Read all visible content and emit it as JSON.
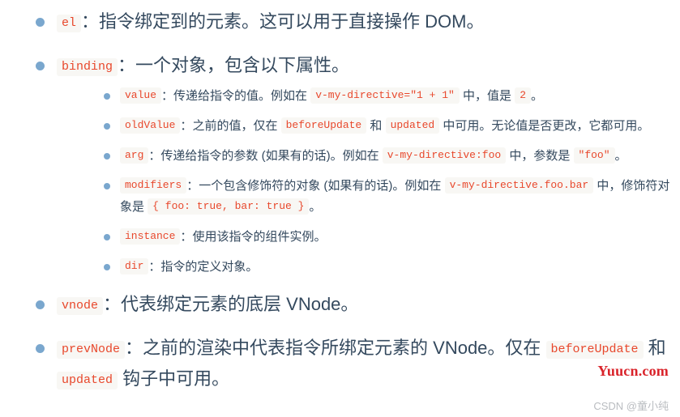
{
  "document": {
    "kind": "vue-custom-directive-hook-arguments",
    "items": [
      {
        "id": "el",
        "code": "el",
        "colon": "：",
        "text": "指令绑定到的元素。这可以用于直接操作 DOM。"
      },
      {
        "id": "binding",
        "code": "binding",
        "colon": "：",
        "text": "一个对象，包含以下属性。",
        "children": [
          {
            "id": "value",
            "code": "value",
            "colon": "：",
            "runs": [
              {
                "type": "text",
                "value": "传递给指令的值。例如在 "
              },
              {
                "type": "code",
                "value": "v-my-directive=\"1 + 1\""
              },
              {
                "type": "text",
                "value": " 中，值是 "
              },
              {
                "type": "code",
                "value": "2"
              },
              {
                "type": "text",
                "value": "。"
              }
            ]
          },
          {
            "id": "oldValue",
            "code": "oldValue",
            "colon": "：",
            "runs": [
              {
                "type": "text",
                "value": "之前的值，仅在 "
              },
              {
                "type": "code",
                "value": "beforeUpdate"
              },
              {
                "type": "text",
                "value": " 和 "
              },
              {
                "type": "code",
                "value": "updated"
              },
              {
                "type": "text",
                "value": " 中可用。无论值是否更改，它都可用。"
              }
            ]
          },
          {
            "id": "arg",
            "code": "arg",
            "colon": "：",
            "runs": [
              {
                "type": "text",
                "value": "传递给指令的参数 (如果有的话)。例如在 "
              },
              {
                "type": "code",
                "value": "v-my-directive:foo"
              },
              {
                "type": "text",
                "value": " 中，参数是 "
              },
              {
                "type": "code",
                "value": "\"foo\""
              },
              {
                "type": "text",
                "value": "。"
              }
            ]
          },
          {
            "id": "modifiers",
            "code": "modifiers",
            "colon": "：",
            "runs": [
              {
                "type": "text",
                "value": "一个包含修饰符的对象 (如果有的话)。例如在 "
              },
              {
                "type": "code",
                "value": "v-my-directive.foo.bar"
              },
              {
                "type": "text",
                "value": " 中，修饰符对象是 "
              },
              {
                "type": "code",
                "value": "{ foo: true, bar: true }"
              },
              {
                "type": "text",
                "value": "。"
              }
            ]
          },
          {
            "id": "instance",
            "code": "instance",
            "colon": "：",
            "runs": [
              {
                "type": "text",
                "value": "使用该指令的组件实例。"
              }
            ]
          },
          {
            "id": "dir",
            "code": "dir",
            "colon": "：",
            "runs": [
              {
                "type": "text",
                "value": "指令的定义对象。"
              }
            ]
          }
        ]
      },
      {
        "id": "vnode",
        "code": "vnode",
        "colon": "：",
        "text": "代表绑定元素的底层 VNode。"
      },
      {
        "id": "prevNode",
        "code": "prevNode",
        "colon": "：",
        "runs": [
          {
            "type": "text",
            "value": "之前的渲染中代表指令所绑定元素的 VNode。仅在 "
          },
          {
            "type": "code",
            "value": "beforeUpdate"
          },
          {
            "type": "text",
            "value": " 和 "
          },
          {
            "type": "code",
            "value": "updated"
          },
          {
            "type": "text",
            "value": " 钩子中可用。"
          }
        ]
      }
    ]
  },
  "watermarks": {
    "primary": "Yuucn.com",
    "secondary": "CSDN @童小纯"
  },
  "colors": {
    "text": "#34495e",
    "bullet": "#7aa7ce",
    "code_text": "#e8482c",
    "code_bg": "#f8f7f4",
    "watermark_primary": "#d9232a",
    "watermark_secondary": "#b9bcc0",
    "page_bg": "#ffffff"
  }
}
